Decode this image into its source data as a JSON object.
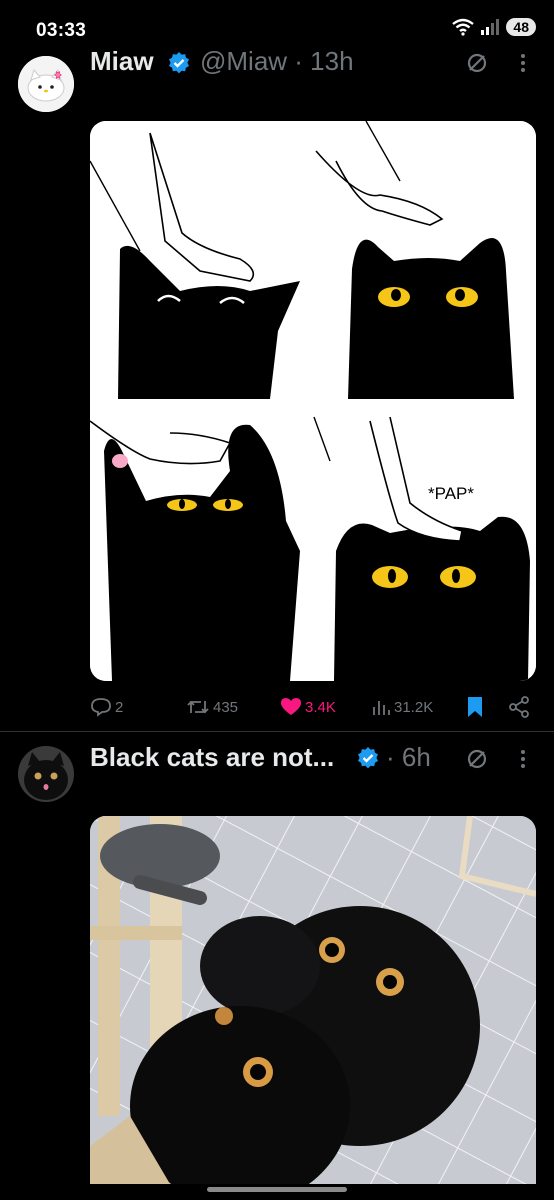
{
  "status_bar": {
    "time": "03:33",
    "battery": "48"
  },
  "tweets": [
    {
      "author": "Miaw",
      "handle_time": "@Miaw · 13h",
      "stats": {
        "replies": "2",
        "reposts": "435",
        "likes": "3.4K",
        "views": "31.2K"
      }
    },
    {
      "author": "Black cats are not...",
      "handle_time": "· 6h"
    }
  ],
  "colors": {
    "like": "#f91880",
    "verified": "#1d9bf0",
    "bookmark": "#1d9bf0",
    "muted": "#71767b"
  },
  "icons": [
    "verified-badge-icon",
    "grok-icon",
    "more-icon",
    "reply-icon",
    "repost-icon",
    "like-icon",
    "views-icon",
    "bookmark-icon",
    "share-icon"
  ]
}
